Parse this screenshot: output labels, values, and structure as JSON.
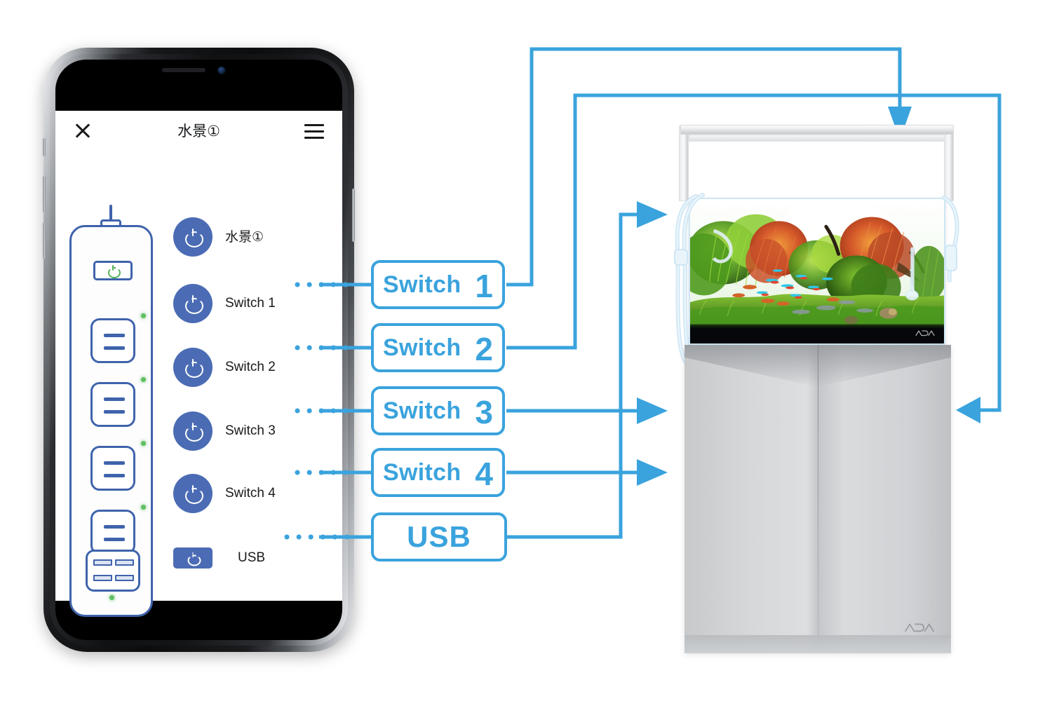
{
  "app": {
    "title": "水景①",
    "close_icon": "close-x-icon",
    "menu_icon": "hamburger-menu-icon",
    "rows": [
      {
        "id": "scene",
        "label": "水景①",
        "button_type": "circle",
        "icon": "power-icon"
      },
      {
        "id": "sw1",
        "label": "Switch 1",
        "button_type": "circle",
        "icon": "power-icon"
      },
      {
        "id": "sw2",
        "label": "Switch 2",
        "button_type": "circle",
        "icon": "power-icon"
      },
      {
        "id": "sw3",
        "label": "Switch 3",
        "button_type": "circle",
        "icon": "power-icon"
      },
      {
        "id": "sw4",
        "label": "Switch 4",
        "button_type": "circle",
        "icon": "power-icon"
      },
      {
        "id": "usb",
        "label": "USB",
        "button_type": "rect",
        "icon": "power-icon"
      }
    ],
    "power_strip": {
      "name": "power-strip-illustration",
      "master_switch_icon": "power-icon",
      "outlet_count": 4,
      "usb_port_count": 4,
      "led_color": "#5fbf63",
      "outline_color": "#3f63ac"
    }
  },
  "callouts": [
    {
      "id": "c1",
      "word": "Switch",
      "num": "1",
      "target": "aquarium-light"
    },
    {
      "id": "c2",
      "word": "Switch",
      "num": "2",
      "target": "cabinet-right-side"
    },
    {
      "id": "c3",
      "word": "Switch",
      "num": "3",
      "target": "cabinet-left-upper"
    },
    {
      "id": "c4",
      "word": "Switch",
      "num": "4",
      "target": "cabinet-left-lower"
    },
    {
      "id": "c5",
      "word": "USB",
      "num": "",
      "target": "aquarium-tank-left"
    }
  ],
  "equipment": {
    "name": "planted-aquarium-with-cabinet",
    "light_fixture": "aquarium-led-light",
    "tank": "planted-glass-aquarium",
    "cabinet": "aquarium-cabinet-stand",
    "brand_logo": "ADA"
  },
  "colors": {
    "accent_blue": "#3aa3dd",
    "app_button_blue": "#4b6cb4",
    "strip_outline": "#3f63ac",
    "led_green": "#5fbf63",
    "text_dark": "#1a1a1a"
  }
}
